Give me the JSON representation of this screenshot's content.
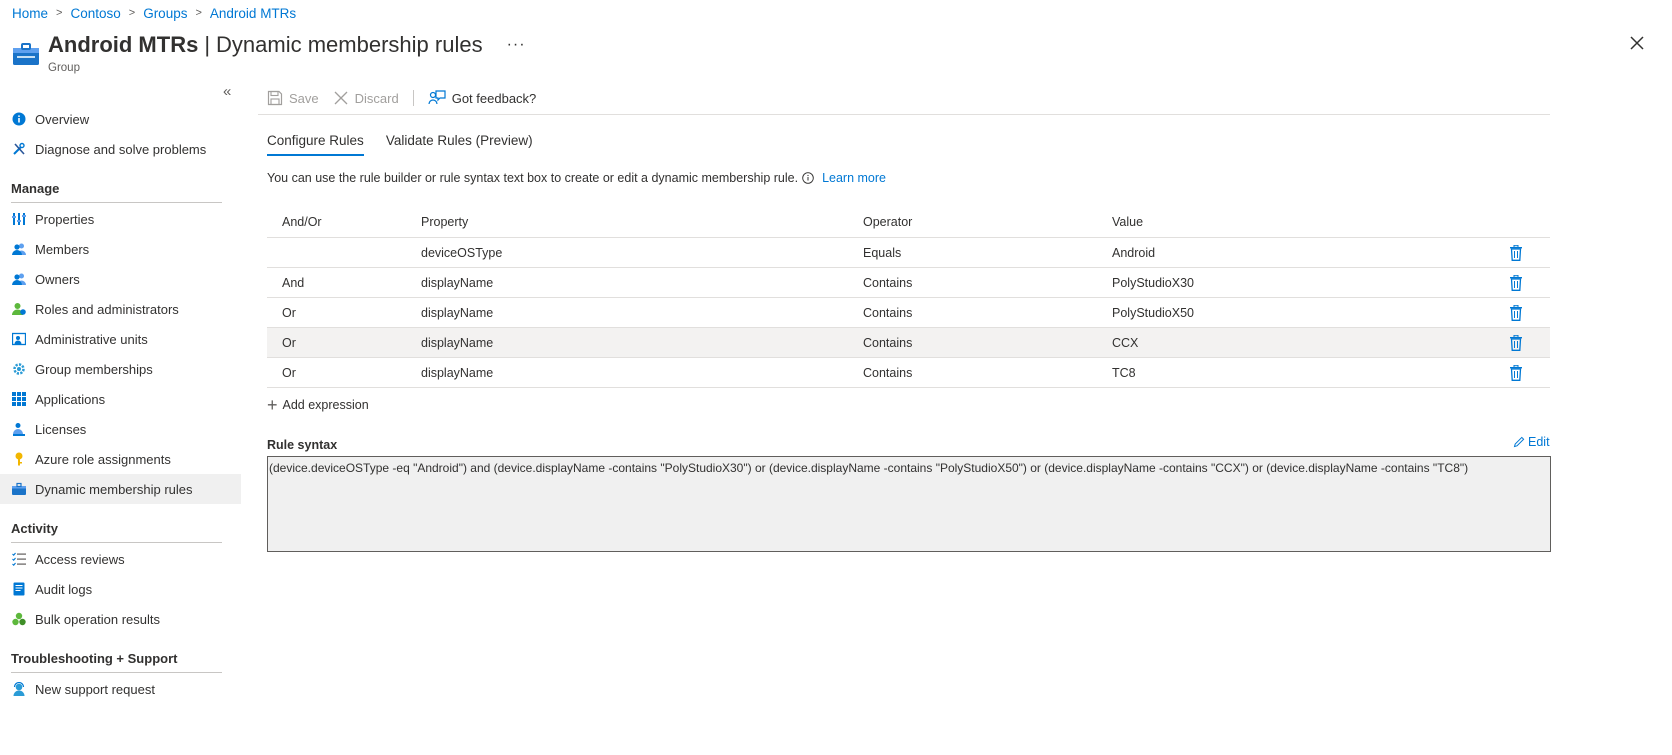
{
  "breadcrumb": [
    "Home",
    "Contoso",
    "Groups",
    "Android MTRs"
  ],
  "header": {
    "title": "Android MTRs",
    "title_separator": "|",
    "page": "Dynamic membership rules",
    "subtitle": "Group",
    "more": "···"
  },
  "sidebar": {
    "collapse": "«",
    "top_items": [
      {
        "label": "Overview",
        "icon": "info-icon"
      },
      {
        "label": "Diagnose and solve problems",
        "icon": "wrench-icon"
      }
    ],
    "sections": [
      {
        "title": "Manage",
        "items": [
          {
            "label": "Properties",
            "icon": "properties-icon"
          },
          {
            "label": "Members",
            "icon": "members-icon"
          },
          {
            "label": "Owners",
            "icon": "owners-icon"
          },
          {
            "label": "Roles and administrators",
            "icon": "roles-icon"
          },
          {
            "label": "Administrative units",
            "icon": "admin-units-icon"
          },
          {
            "label": "Group memberships",
            "icon": "gear-icon"
          },
          {
            "label": "Applications",
            "icon": "grid-icon"
          },
          {
            "label": "Licenses",
            "icon": "license-icon"
          },
          {
            "label": "Azure role assignments",
            "icon": "key-icon"
          },
          {
            "label": "Dynamic membership rules",
            "icon": "group-icon",
            "active": true
          }
        ]
      },
      {
        "title": "Activity",
        "items": [
          {
            "label": "Access reviews",
            "icon": "checklist-icon"
          },
          {
            "label": "Audit logs",
            "icon": "audit-log-icon"
          },
          {
            "label": "Bulk operation results",
            "icon": "bulk-icon"
          }
        ]
      },
      {
        "title": "Troubleshooting + Support",
        "items": [
          {
            "label": "New support request",
            "icon": "support-icon"
          }
        ]
      }
    ]
  },
  "toolbar": {
    "save_label": "Save",
    "discard_label": "Discard",
    "feedback_label": "Got feedback?"
  },
  "tabs": [
    {
      "label": "Configure Rules",
      "active": true
    },
    {
      "label": "Validate Rules (Preview)",
      "active": false
    }
  ],
  "info": {
    "text": "You can use the rule builder or rule syntax text box to create or edit a dynamic membership rule.",
    "link": "Learn more"
  },
  "table": {
    "headers": [
      "And/Or",
      "Property",
      "Operator",
      "Value"
    ],
    "rows": [
      {
        "andor": "",
        "property": "deviceOSType",
        "operator": "Equals",
        "value": "Android"
      },
      {
        "andor": "And",
        "property": "displayName",
        "operator": "Contains",
        "value": "PolyStudioX30"
      },
      {
        "andor": "Or",
        "property": "displayName",
        "operator": "Contains",
        "value": "PolyStudioX50"
      },
      {
        "andor": "Or",
        "property": "displayName",
        "operator": "Contains",
        "value": "CCX",
        "hover": true
      },
      {
        "andor": "Or",
        "property": "displayName",
        "operator": "Contains",
        "value": "TC8"
      }
    ]
  },
  "add_expression": "Add expression",
  "rule_syntax": {
    "label": "Rule syntax",
    "edit": "Edit",
    "text": "(device.deviceOSType -eq \"Android\") and (device.displayName -contains \"PolyStudioX30\") or (device.displayName -contains \"PolyStudioX50\") or (device.displayName -contains \"CCX\") or (device.displayName -contains \"TC8\")"
  },
  "colors": {
    "accent": "#0078d4",
    "active_nav_bg": "#f0f0f0",
    "syntax_bg": "#f0f0f0"
  }
}
